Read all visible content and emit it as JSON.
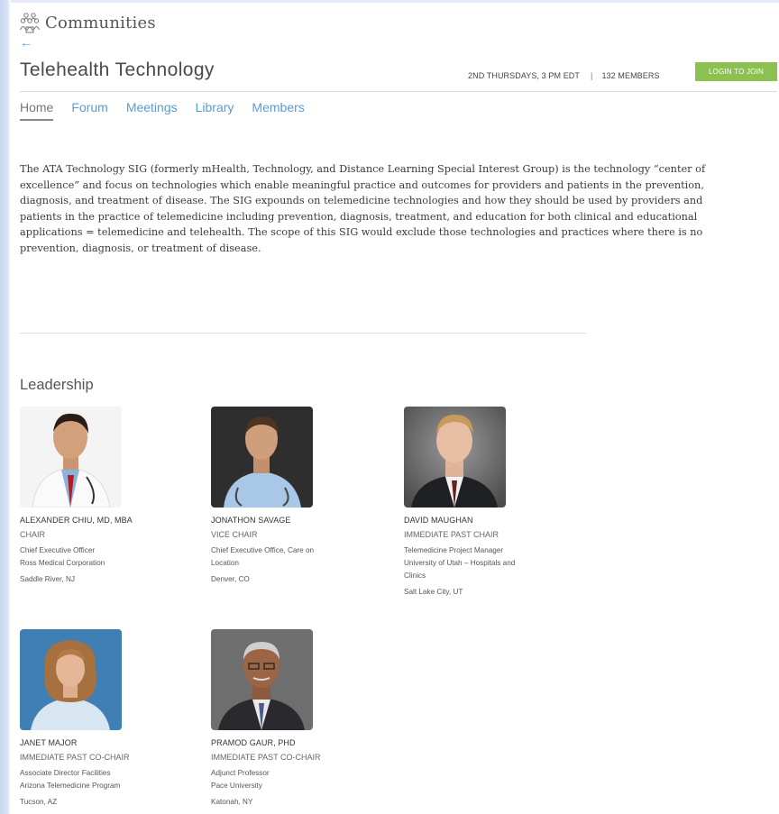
{
  "header": {
    "brand_title": "Communities",
    "back_arrow": "←",
    "page_title": "Telehealth Technology",
    "meeting_schedule": "2ND THURSDAYS, 3 PM EDT",
    "separator": "|",
    "members_count": "132 MEMBERS",
    "login_label": "LOGIN TO JOIN",
    "accent_color": "#5b9bd5",
    "login_color": "#8cc152"
  },
  "tabs": [
    {
      "label": "Home",
      "active": true
    },
    {
      "label": "Forum",
      "active": false
    },
    {
      "label": "Meetings",
      "active": false
    },
    {
      "label": "Library",
      "active": false
    },
    {
      "label": "Members",
      "active": false
    }
  ],
  "description": "The ATA Technology SIG (formerly mHealth, Technology, and Distance Learning Special Interest Group) is the technology “center of excellence” and focus on technologies which enable meaningful practice and outcomes for providers and patients in the prevention, diagnosis, and treatment of disease. The SIG expounds on telemedicine technologies and how they should be used by providers and patients in the practice of telemedicine including prevention, diagnosis, treatment, and education for both clinical and educational applications = telemedicine and telehealth. The scope of this SIG would exclude those technologies and practices where there is no prevention, diagnosis, or treatment of disease.",
  "leadership": {
    "title": "Leadership",
    "leaders": [
      {
        "name": "ALEXANDER CHIU, MD, MBA",
        "role": "CHAIR",
        "title_line1": "Chief Executive Officer",
        "title_line2": "Ross Medical Corporation",
        "title_line3": "",
        "location": "Saddle River, NJ"
      },
      {
        "name": "JONATHON SAVAGE",
        "role": "VICE CHAIR",
        "title_line1": "Chief Executive Office, Care on",
        "title_line2": "Location",
        "title_line3": "",
        "location": "Denver, CO"
      },
      {
        "name": "DAVID MAUGHAN",
        "role": "IMMEDIATE PAST CHAIR",
        "title_line1": "Telemedicine Project Manager",
        "title_line2": "University of Utah – Hospitals and",
        "title_line3": "Clinics",
        "location": "Salt Lake City, UT"
      },
      {
        "name": "JANET MAJOR",
        "role": "IMMEDIATE PAST CO-CHAIR",
        "title_line1": "Associate Director Facilities",
        "title_line2": "Arizona Telemedicine Program",
        "title_line3": "",
        "location": "Tucson, AZ"
      },
      {
        "name": "PRAMOD GAUR, PHD",
        "role": "IMMEDIATE PAST CO-CHAIR",
        "title_line1": "Adjunct Professor",
        "title_line2": "Pace University",
        "title_line3": "",
        "location": "Katonah, NY"
      }
    ]
  }
}
